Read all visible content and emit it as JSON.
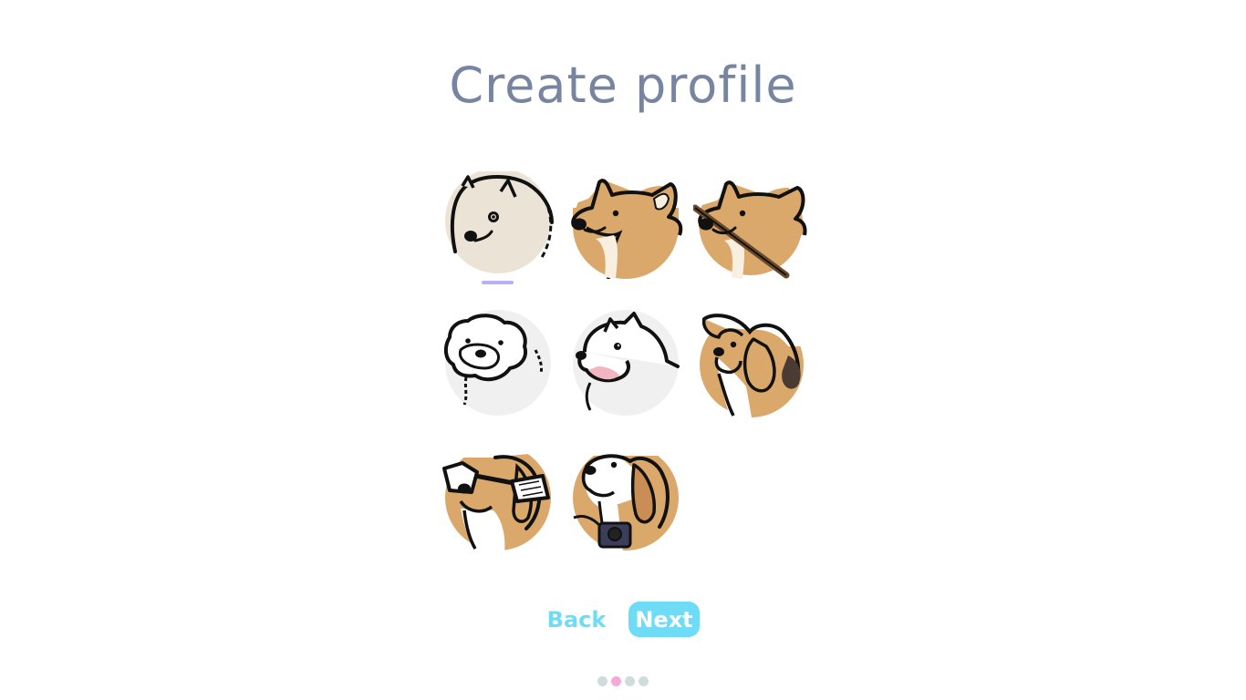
{
  "page": {
    "title": "Create profile"
  },
  "avatars": {
    "selected_index": 0,
    "items": [
      {
        "name": "samoyed-avatar-icon",
        "bg": "#ebe3d6"
      },
      {
        "name": "corgi-avatar-icon",
        "bg": "#d9a86a"
      },
      {
        "name": "corgi-with-stick-avatar-icon",
        "bg": "#d9a86a"
      },
      {
        "name": "bichon-avatar-icon",
        "bg": "#eff0ef"
      },
      {
        "name": "husky-avatar-icon",
        "bg": "#eff0ef"
      },
      {
        "name": "beagle-avatar-icon",
        "bg": "#d9a86a"
      },
      {
        "name": "beagle-with-binoculars-avatar-icon",
        "bg": "#d9a86a"
      },
      {
        "name": "beagle-with-camera-avatar-icon",
        "bg": "#d9a86a"
      }
    ]
  },
  "nav": {
    "back_label": "Back",
    "next_label": "Next"
  },
  "pagination": {
    "total": 4,
    "current": 2
  },
  "colors": {
    "title": "#7785a1",
    "accent": "#6edcf7",
    "selection": "#b6b0f5",
    "dot_active": "#f7a8d8",
    "dot_inactive": "#cfdcdc",
    "outline": "#111111"
  }
}
